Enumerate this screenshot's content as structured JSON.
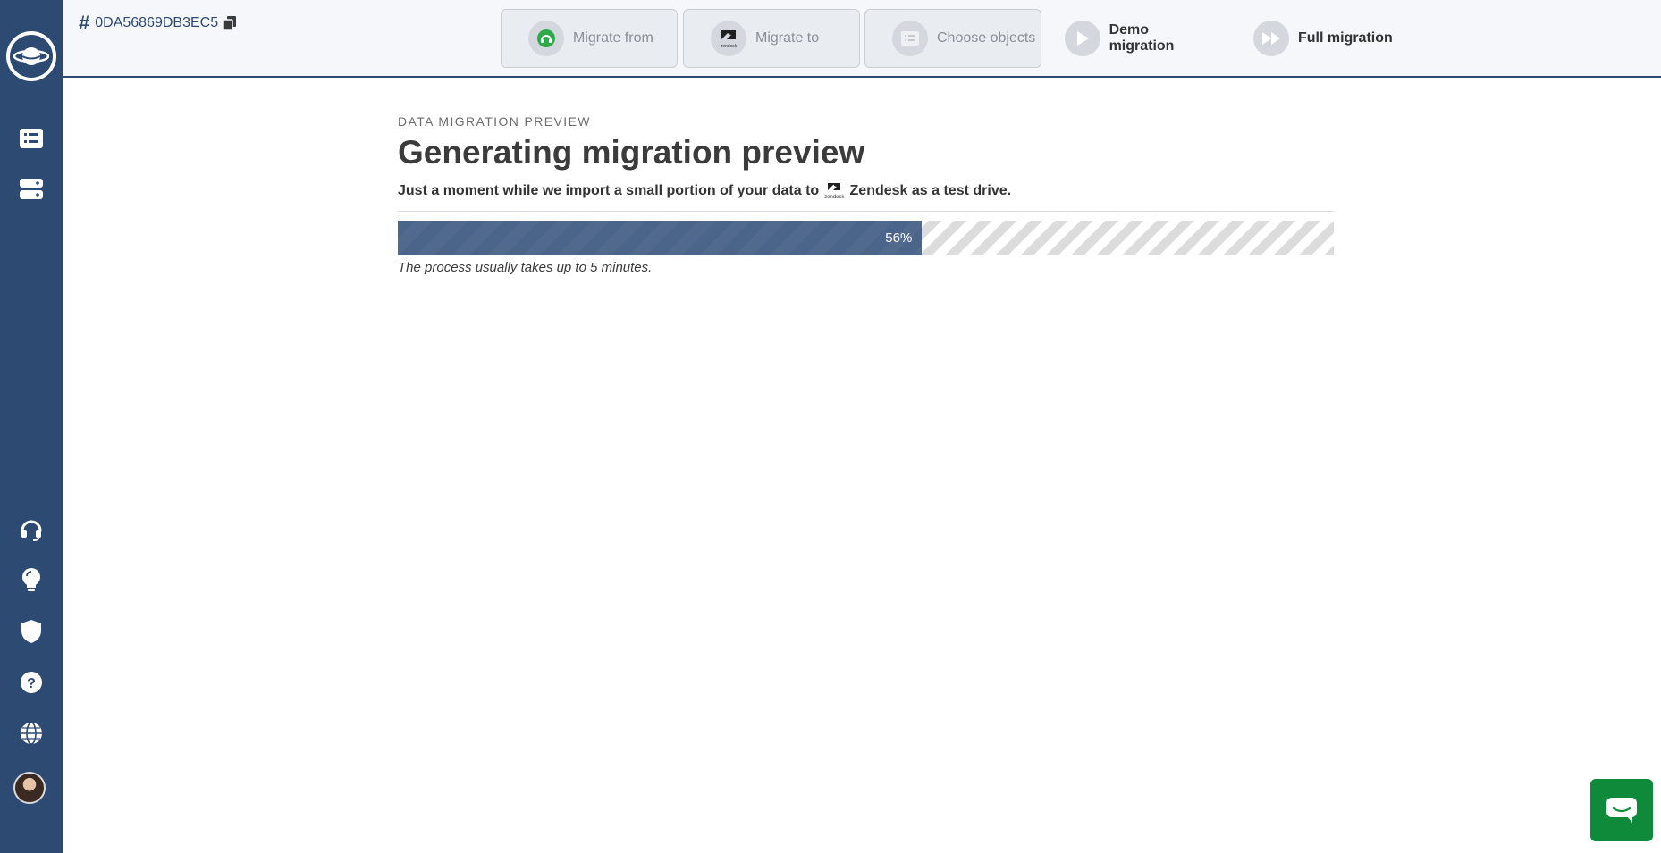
{
  "project": {
    "hash": "#",
    "id": "0DA56869DB3EC5"
  },
  "steps": [
    {
      "label": "Migrate from",
      "icon": "helpdesk-logo-icon"
    },
    {
      "label": "Migrate to",
      "icon": "zendesk-logo-icon"
    },
    {
      "label": "Choose objects",
      "icon": "list-icon"
    },
    {
      "label": "Demo migration",
      "icon": "play-icon"
    },
    {
      "label": "Full migration",
      "icon": "fast-forward-icon"
    }
  ],
  "main": {
    "overline": "DATA MIGRATION PREVIEW",
    "title": "Generating migration preview",
    "subtitle_before": "Just a moment while we import a small portion of your data to",
    "subtitle_after": "Zendesk as a test drive.",
    "zendesk_mini": "zendesk",
    "progress_text": "56%",
    "progress_value": 56,
    "note": "The process usually takes up to 5 minutes."
  },
  "colors": {
    "sidebar": "#2d4a73",
    "progress": "#4b6489",
    "chat": "#0f8a3a",
    "from_logo": "#2eaa4a"
  }
}
